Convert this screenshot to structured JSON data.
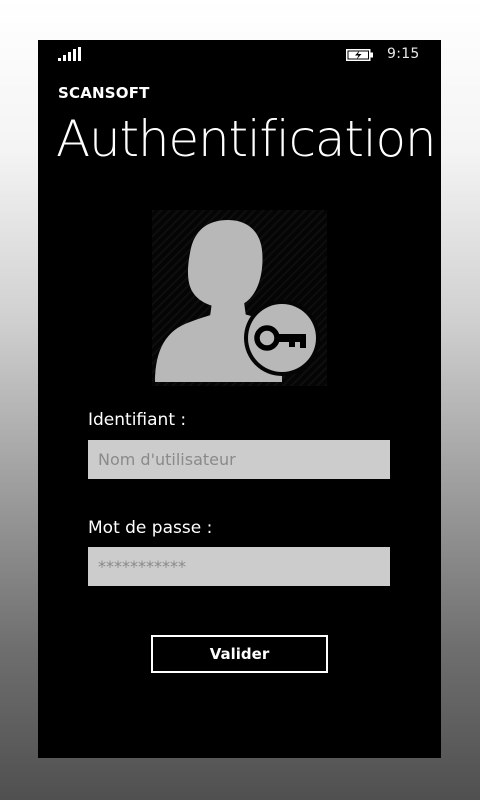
{
  "status_bar": {
    "signal_icon": "signal-strength-icon",
    "battery_icon": "battery-charging-icon",
    "time": "9:15"
  },
  "header": {
    "app_name": "SCANSOFT",
    "title": "Authentification"
  },
  "avatar": {
    "icon": "user-key-icon"
  },
  "form": {
    "username_label": "Identifiant :",
    "username_placeholder": "Nom d'utilisateur",
    "password_label": "Mot de passe :",
    "password_placeholder": "***********",
    "submit_label": "Valider"
  },
  "colors": {
    "screen_background": "#000000",
    "input_background": "#cccccc",
    "text": "#ffffff",
    "icon": "#b8b8b8"
  }
}
